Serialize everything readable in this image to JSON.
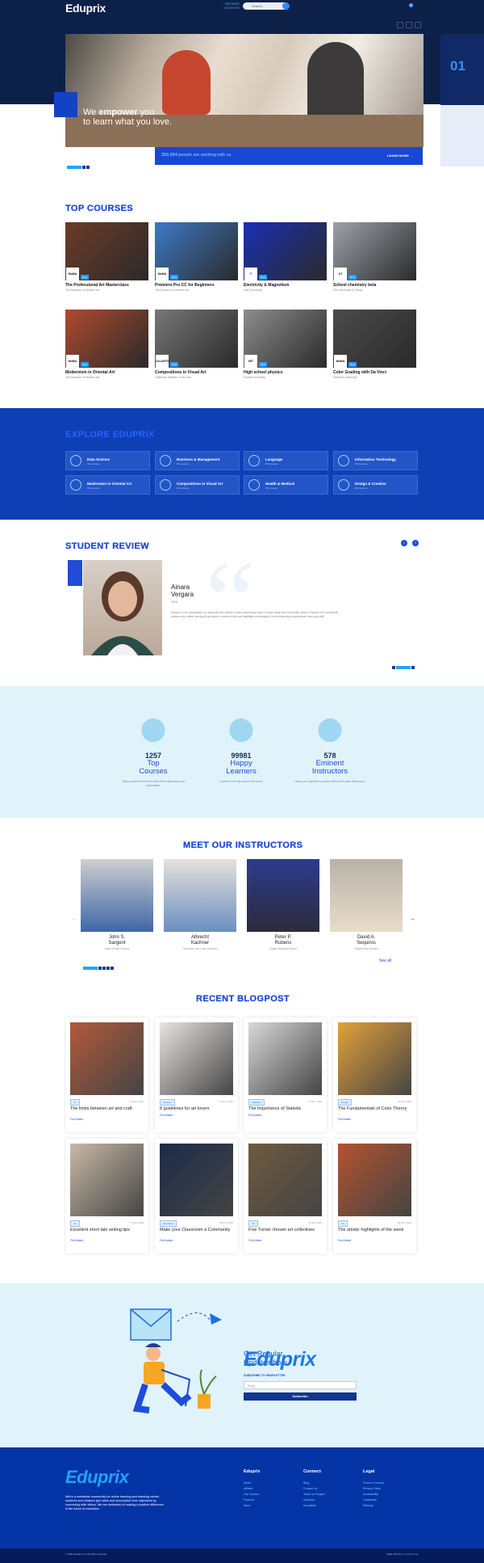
{
  "header": {
    "logo": "Eduprix",
    "nav_line1": "BROWSE",
    "nav_line2": "COURSES",
    "search_placeholder": "Search..."
  },
  "hero": {
    "line1_pre": "We ",
    "line1_bold": "empower",
    "line1_post": " you",
    "line2": "to learn what you love.",
    "slide_number": "01",
    "stats_count": "250,994",
    "stats_text": " people are working with us",
    "learn_more": "LEARN MORE →"
  },
  "courses": {
    "title": "TOP COURSES",
    "new_label": "New",
    "items": [
      {
        "title": "The Professional Art Masterclass",
        "sub": "The Museum of Modern Art",
        "badge": "MoMA",
        "color": "#6e3b28"
      },
      {
        "title": "Premiere Pro CC for Beginners",
        "sub": "The Museum of Modern Art",
        "badge": "MoMA",
        "color": "#3d7ac8"
      },
      {
        "title": "Electricity & Magnetism",
        "sub": "Yale University",
        "badge": "Y",
        "color": "#1a2fb5"
      },
      {
        "title": "School chemistry beta",
        "sub": "The University of Texas",
        "badge": "UT",
        "color": "#9da2aa"
      },
      {
        "title": "Modernism in Oriental Art",
        "sub": "The Museum of Modern Art",
        "badge": "MoMA",
        "color": "#b04a2e"
      },
      {
        "title": "Compositions in Visual Art",
        "sub": "California Institute of the Arts",
        "badge": "CALARTS",
        "color": "#777"
      },
      {
        "title": "High school physics",
        "sub": "Florida University",
        "badge": "MIT",
        "color": "#8d8d8d"
      },
      {
        "title": "Color Grading with Da Vinci",
        "sub": "Stanford University",
        "badge": "MoMA",
        "color": "#4a4a4a"
      }
    ]
  },
  "explore": {
    "title": "EXPLORE EDUPRIX",
    "categories": [
      {
        "name": "Data Science",
        "count": "68 Courses"
      },
      {
        "name": "Business & Management",
        "count": "68 Courses"
      },
      {
        "name": "Language",
        "count": "68 Courses"
      },
      {
        "name": "Information Technology",
        "count": "68 Courses"
      },
      {
        "name": "Modernism in Oriental Art",
        "count": "68 Courses"
      },
      {
        "name": "Compositions in Visual Art",
        "count": "68 Courses"
      },
      {
        "name": "Health & Medical",
        "count": "68 Courses"
      },
      {
        "name": "Design & Creative",
        "count": "68 Courses"
      }
    ]
  },
  "review": {
    "title": "STUDENT REVIEW",
    "first_name": "Ainara",
    "last_name": "Vergara",
    "location": "USA",
    "text": "Eduprix is our destination for anybody who wants to learn something new or share what they know with others. Eduprix is a worldwide platform for online learning that helps to connect with and facilitate exchanges of online learning experiences from any skill."
  },
  "stats": [
    {
      "number": "1257",
      "label1": "Top",
      "label2": "Courses",
      "desc": "Take courses from the world's best instructors and universities."
    },
    {
      "number": "99981",
      "label1": "Happy",
      "label2": "Learners",
      "desc": "Learners from all around the world."
    },
    {
      "number": "578",
      "label1": "Eminent",
      "label2": "Instructors",
      "desc": "Learn your favourite courses with world class instructors."
    }
  ],
  "instructors": {
    "title": "MEET OUR INSTRUCTORS",
    "see_all": "See all",
    "items": [
      {
        "first": "John S.",
        "last": "Sargent",
        "role": "Head of Data Science"
      },
      {
        "first": "Albrecht",
        "last": "Kachner",
        "role": "Developer and Lead Instructor"
      },
      {
        "first": "Peter P.",
        "last": "Rubens",
        "role": "Digital Marketing Expert"
      },
      {
        "first": "David A.",
        "last": "Sequiros",
        "role": "Engineering Architect"
      }
    ]
  },
  "blog": {
    "title": "RECENT BLOGPOST",
    "read_more": "Full Article",
    "posts": [
      {
        "tag": "Art",
        "date": "21 Dec 2020",
        "title": "The limits between art and craft"
      },
      {
        "tag": "Lifestyle",
        "date": "19 Dec 2020",
        "title": "8 guidelines for art lovers"
      },
      {
        "tag": "Statistics",
        "date": "17 Dec 2020",
        "title": "The Importance of Statistic"
      },
      {
        "tag": "Design",
        "date": "16 Dec 2020",
        "title": "The Fundamentals of Color Theory"
      },
      {
        "tag": "Art",
        "date": "27 Dec 2020",
        "title": "Excellent short tale writing tips"
      },
      {
        "tag": "Education",
        "date": "30 Dec 2020",
        "title": "Make your Classroom a Community"
      },
      {
        "tag": "Art",
        "date": "15 Dec 2020",
        "title": "Five Turner chosen art collectives"
      },
      {
        "tag": "Art",
        "date": "09 Dec 2020",
        "title": "The artistic highlights of the week"
      }
    ]
  },
  "newsletter": {
    "line1": "Get Regular",
    "line2": "Updates from",
    "brand": "Eduprix",
    "subscribe_label": "SUBSCRIBE TO NEWSLETTER",
    "email_placeholder": "Email",
    "button": "Subscribe"
  },
  "footer": {
    "logo": "Eduprix",
    "description": "We're a worldwide community for online learning and teaching whose students and creators give skills and accomplish their objectives by connecting with others. We are dedicated to making a positive difference in the future of education.",
    "columns": [
      {
        "title": "Eduprix",
        "links": [
          "About",
          "Affiliate",
          "Our Careers",
          "Partners",
          "Store"
        ]
      },
      {
        "title": "Connect",
        "links": [
          "Blog",
          "Contact Us",
          "Teach on Eduprix",
          "Instructor",
          "Newsletter"
        ]
      },
      {
        "title": "Legal",
        "links": [
          "Terms of Service",
          "Privacy Policy",
          "Accessibility",
          "Trademark",
          "Sitemap"
        ]
      }
    ],
    "copyright": "© 2021 Eduprix Inc. All rights reserved.",
    "made_with": "Made with ♥ by",
    "made_by": "CreativeTeam"
  },
  "colors": {
    "primary": "#1f4cd8",
    "navy": "#0d2047",
    "accent": "#21a5ff",
    "light": "#e1f3fa"
  }
}
